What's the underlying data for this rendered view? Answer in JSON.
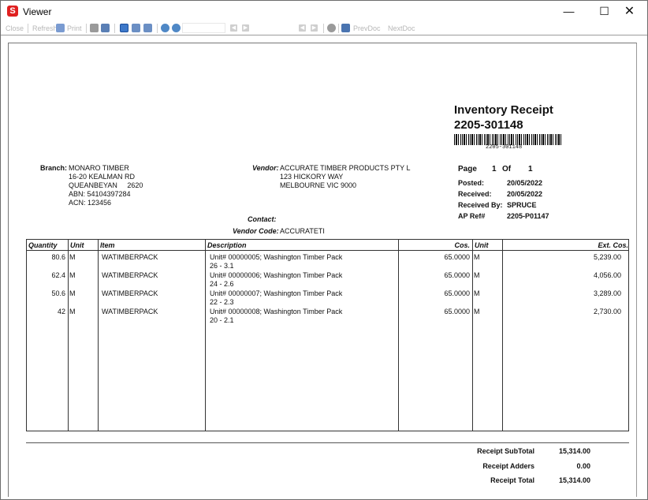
{
  "window": {
    "title": "Viewer",
    "app_icon": "S",
    "minimize": "—",
    "maximize": "☐",
    "close": "✕"
  },
  "toolbar": {
    "close_label": "Close",
    "refresh_label": "Refresh",
    "print_label": "Print",
    "prev_page": "◀",
    "next_page": "▶",
    "first_page": "◀",
    "last_page": "▶",
    "prev_doc": "PrevDoc",
    "next_doc": "NextDoc"
  },
  "report": {
    "title": "Inventory Receipt",
    "number": "2205-301148",
    "barcode_text": "2205-301148",
    "branch_label": "Branch:",
    "branch_lines": [
      "MONARO TIMBER",
      "16-20 KEALMAN RD",
      "QUEANBEYAN     2620",
      "ABN: 54104397284",
      "ACN: 123456"
    ],
    "vendor_label": "Vendor:",
    "vendor_lines": [
      "ACCURATE TIMBER PRODUCTS PTY L",
      "123 HICKORY WAY",
      "MELBOURNE VIC 9000"
    ],
    "contact_label": "Contact:",
    "contact_value": "",
    "vendor_code_label": "Vendor Code:",
    "vendor_code_value": "ACCURATETI",
    "page_label": "Page",
    "page_current": "1",
    "page_of": "Of",
    "page_total": "1",
    "posted_label": "Posted:",
    "posted_value": "20/05/2022",
    "received_label": "Received:",
    "received_value": "20/05/2022",
    "received_by_label": "Received By:",
    "received_by_value": "SPRUCE",
    "ap_ref_label": "AP Ref#",
    "ap_ref_value": "2205-P01147",
    "columns": {
      "quantity": "Quantity",
      "unit": "Unit",
      "item": "Item",
      "description": "Description",
      "cost": "Cos.",
      "unit2": "Unit",
      "ext_cost": "Ext. Cos."
    },
    "rows": [
      {
        "quantity": "80.6",
        "unit": "M",
        "item": "WATIMBERPACK",
        "desc1": "Unit# 00000005; Washington Timber Pack",
        "desc2": "26 - 3.1",
        "cost": "65.0000",
        "unit2": "M",
        "ext_cost": "5,239.00"
      },
      {
        "quantity": "62.4",
        "unit": "M",
        "item": "WATIMBERPACK",
        "desc1": "Unit# 00000006; Washington Timber Pack",
        "desc2": "24 - 2.6",
        "cost": "65.0000",
        "unit2": "M",
        "ext_cost": "4,056.00"
      },
      {
        "quantity": "50.6",
        "unit": "M",
        "item": "WATIMBERPACK",
        "desc1": "Unit# 00000007; Washington Timber Pack",
        "desc2": "22 - 2.3",
        "cost": "65.0000",
        "unit2": "M",
        "ext_cost": "3,289.00"
      },
      {
        "quantity": "42",
        "unit": "M",
        "item": "WATIMBERPACK",
        "desc1": "Unit# 00000008; Washington Timber Pack",
        "desc2": "20 - 2.1",
        "cost": "65.0000",
        "unit2": "M",
        "ext_cost": "2,730.00"
      }
    ],
    "subtotal_label": "Receipt SubTotal",
    "subtotal_value": "15,314.00",
    "adders_label": "Receipt Adders",
    "adders_value": "0.00",
    "total_label": "Receipt Total",
    "total_value": "15,314.00"
  }
}
